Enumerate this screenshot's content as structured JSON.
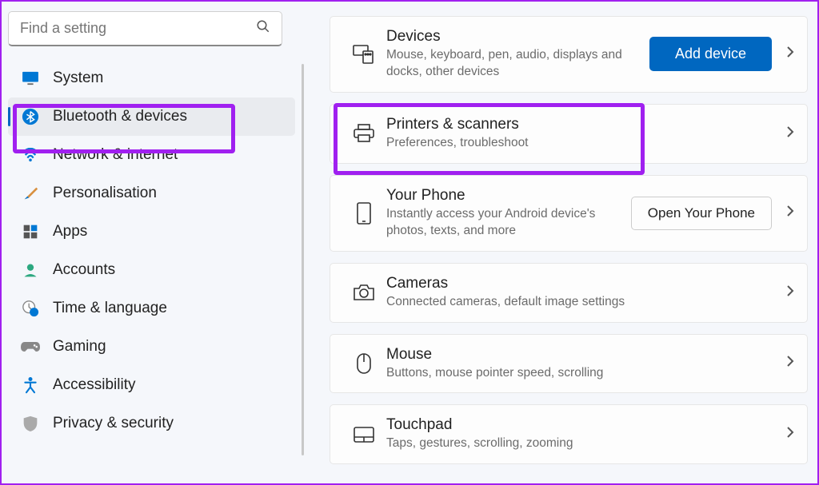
{
  "search": {
    "placeholder": "Find a setting"
  },
  "sidebar": {
    "items": [
      {
        "label": "System"
      },
      {
        "label": "Bluetooth & devices"
      },
      {
        "label": "Network & internet"
      },
      {
        "label": "Personalisation"
      },
      {
        "label": "Apps"
      },
      {
        "label": "Accounts"
      },
      {
        "label": "Time & language"
      },
      {
        "label": "Gaming"
      },
      {
        "label": "Accessibility"
      },
      {
        "label": "Privacy & security"
      }
    ]
  },
  "main": {
    "cards": [
      {
        "title": "Devices",
        "sub": "Mouse, keyboard, pen, audio, displays and docks, other devices",
        "action": "Add device"
      },
      {
        "title": "Printers & scanners",
        "sub": "Preferences, troubleshoot"
      },
      {
        "title": "Your Phone",
        "sub": "Instantly access your Android device's photos, texts, and more",
        "action": "Open Your Phone"
      },
      {
        "title": "Cameras",
        "sub": "Connected cameras, default image settings"
      },
      {
        "title": "Mouse",
        "sub": "Buttons, mouse pointer speed, scrolling"
      },
      {
        "title": "Touchpad",
        "sub": "Taps, gestures, scrolling, zooming"
      }
    ]
  }
}
